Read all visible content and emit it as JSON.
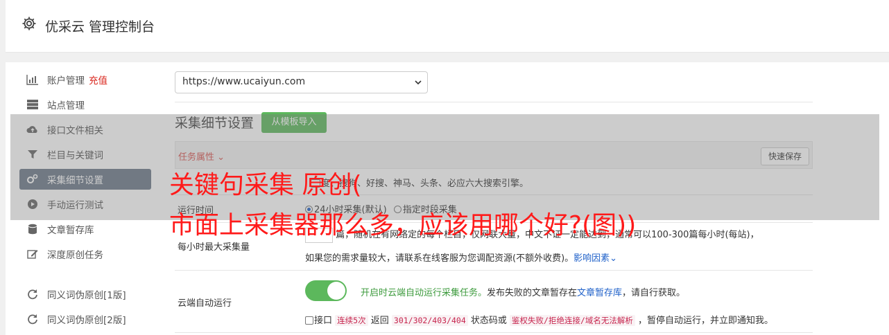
{
  "header": {
    "title": "优采云 管理控制台"
  },
  "sidebar": {
    "items": [
      {
        "label": "账户管理",
        "badge": "充值",
        "icon": "bar-chart-icon"
      },
      {
        "label": "站点管理",
        "icon": "server-icon"
      },
      {
        "label": "接口文件相关",
        "icon": "cloud-upload-icon"
      },
      {
        "label": "栏目与关键词",
        "icon": "filter-icon"
      },
      {
        "label": "采集细节设置",
        "icon": "gears-icon",
        "active": true
      },
      {
        "label": "手动运行测试",
        "icon": "play-circle-icon"
      },
      {
        "label": "文章暂存库",
        "icon": "database-icon"
      },
      {
        "label": "深度原创任务",
        "icon": "edit-icon"
      },
      {
        "label": "同义词伪原创[1版]",
        "icon": "refresh-icon"
      },
      {
        "label": "同义词伪原创[2版]",
        "icon": "refresh-icon"
      }
    ]
  },
  "site_select": {
    "value": "https://www.ucaiyun.com"
  },
  "section": {
    "title": "采集细节设置",
    "import_button": "从模板导入"
  },
  "task": {
    "header_label": "任务属性",
    "save_button": "快速保存"
  },
  "rows": {
    "engines_text": "度、搜狗、好搜、神马、头条、必应六大搜索引擎。",
    "run_time_label": "运行时间",
    "run_time_opt1": "24小时采集(默认)",
    "run_time_opt2": "指定时段采集",
    "max_label": "每小时最大采集量",
    "max_text_1": "篇，随机在有网络定的每个栏目，仅网联大量，中文不证一定能达到，通常可以100-300篇每小时(每站)，",
    "max_text_2": "如果您的需求量较大，请联系在线客服为您调配资源(不额外收费)。",
    "max_link": "影响因素",
    "cloud_label": "云端自动运行",
    "cloud_text_green": "开启时云端自动运行采集任务。",
    "cloud_text_1": "发布失败的文章暂存在",
    "cloud_link": "文章暂存库",
    "cloud_text_2": "，请自行获取。",
    "iface_1": "接口",
    "iface_code1": "连续5次",
    "iface_2": "返回",
    "iface_code2": "301/302/403/404",
    "iface_3": "状态码或",
    "iface_code3": "鉴权失败/拒绝连接/域名无法解析",
    "iface_4": "，暂停自动运行，并立即通知我。"
  },
  "watermark": {
    "line1": "关键句采集 原创(",
    "line2": "市面上采集器那么多，应该用哪个好?(图))"
  },
  "colors": {
    "accent_green": "#5cb85c",
    "danger_red": "#d9534f",
    "sidebar_active": "#6d7a8a",
    "watermark": "#ff1a1a"
  }
}
